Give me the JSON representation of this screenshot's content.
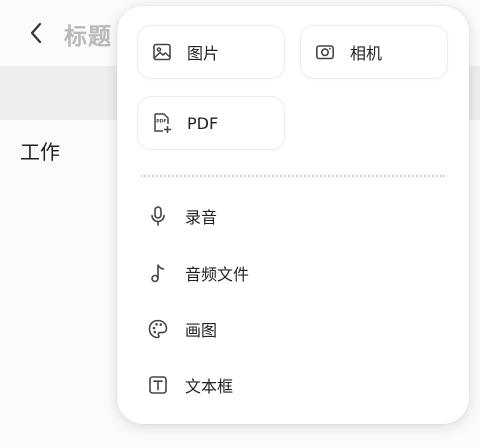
{
  "header": {
    "back_icon": "chevron-left-icon",
    "title": "标题"
  },
  "content": {
    "text": "工作"
  },
  "popup": {
    "tiles": [
      {
        "label": "图片",
        "icon": "image-icon"
      },
      {
        "label": "相机",
        "icon": "camera-icon"
      },
      {
        "label": "PDF",
        "icon": "pdf-add-icon"
      }
    ],
    "items": [
      {
        "label": "录音",
        "icon": "microphone-icon"
      },
      {
        "label": "音频文件",
        "icon": "music-note-icon"
      },
      {
        "label": "画图",
        "icon": "palette-icon"
      },
      {
        "label": "文本框",
        "icon": "text-box-icon"
      }
    ]
  }
}
